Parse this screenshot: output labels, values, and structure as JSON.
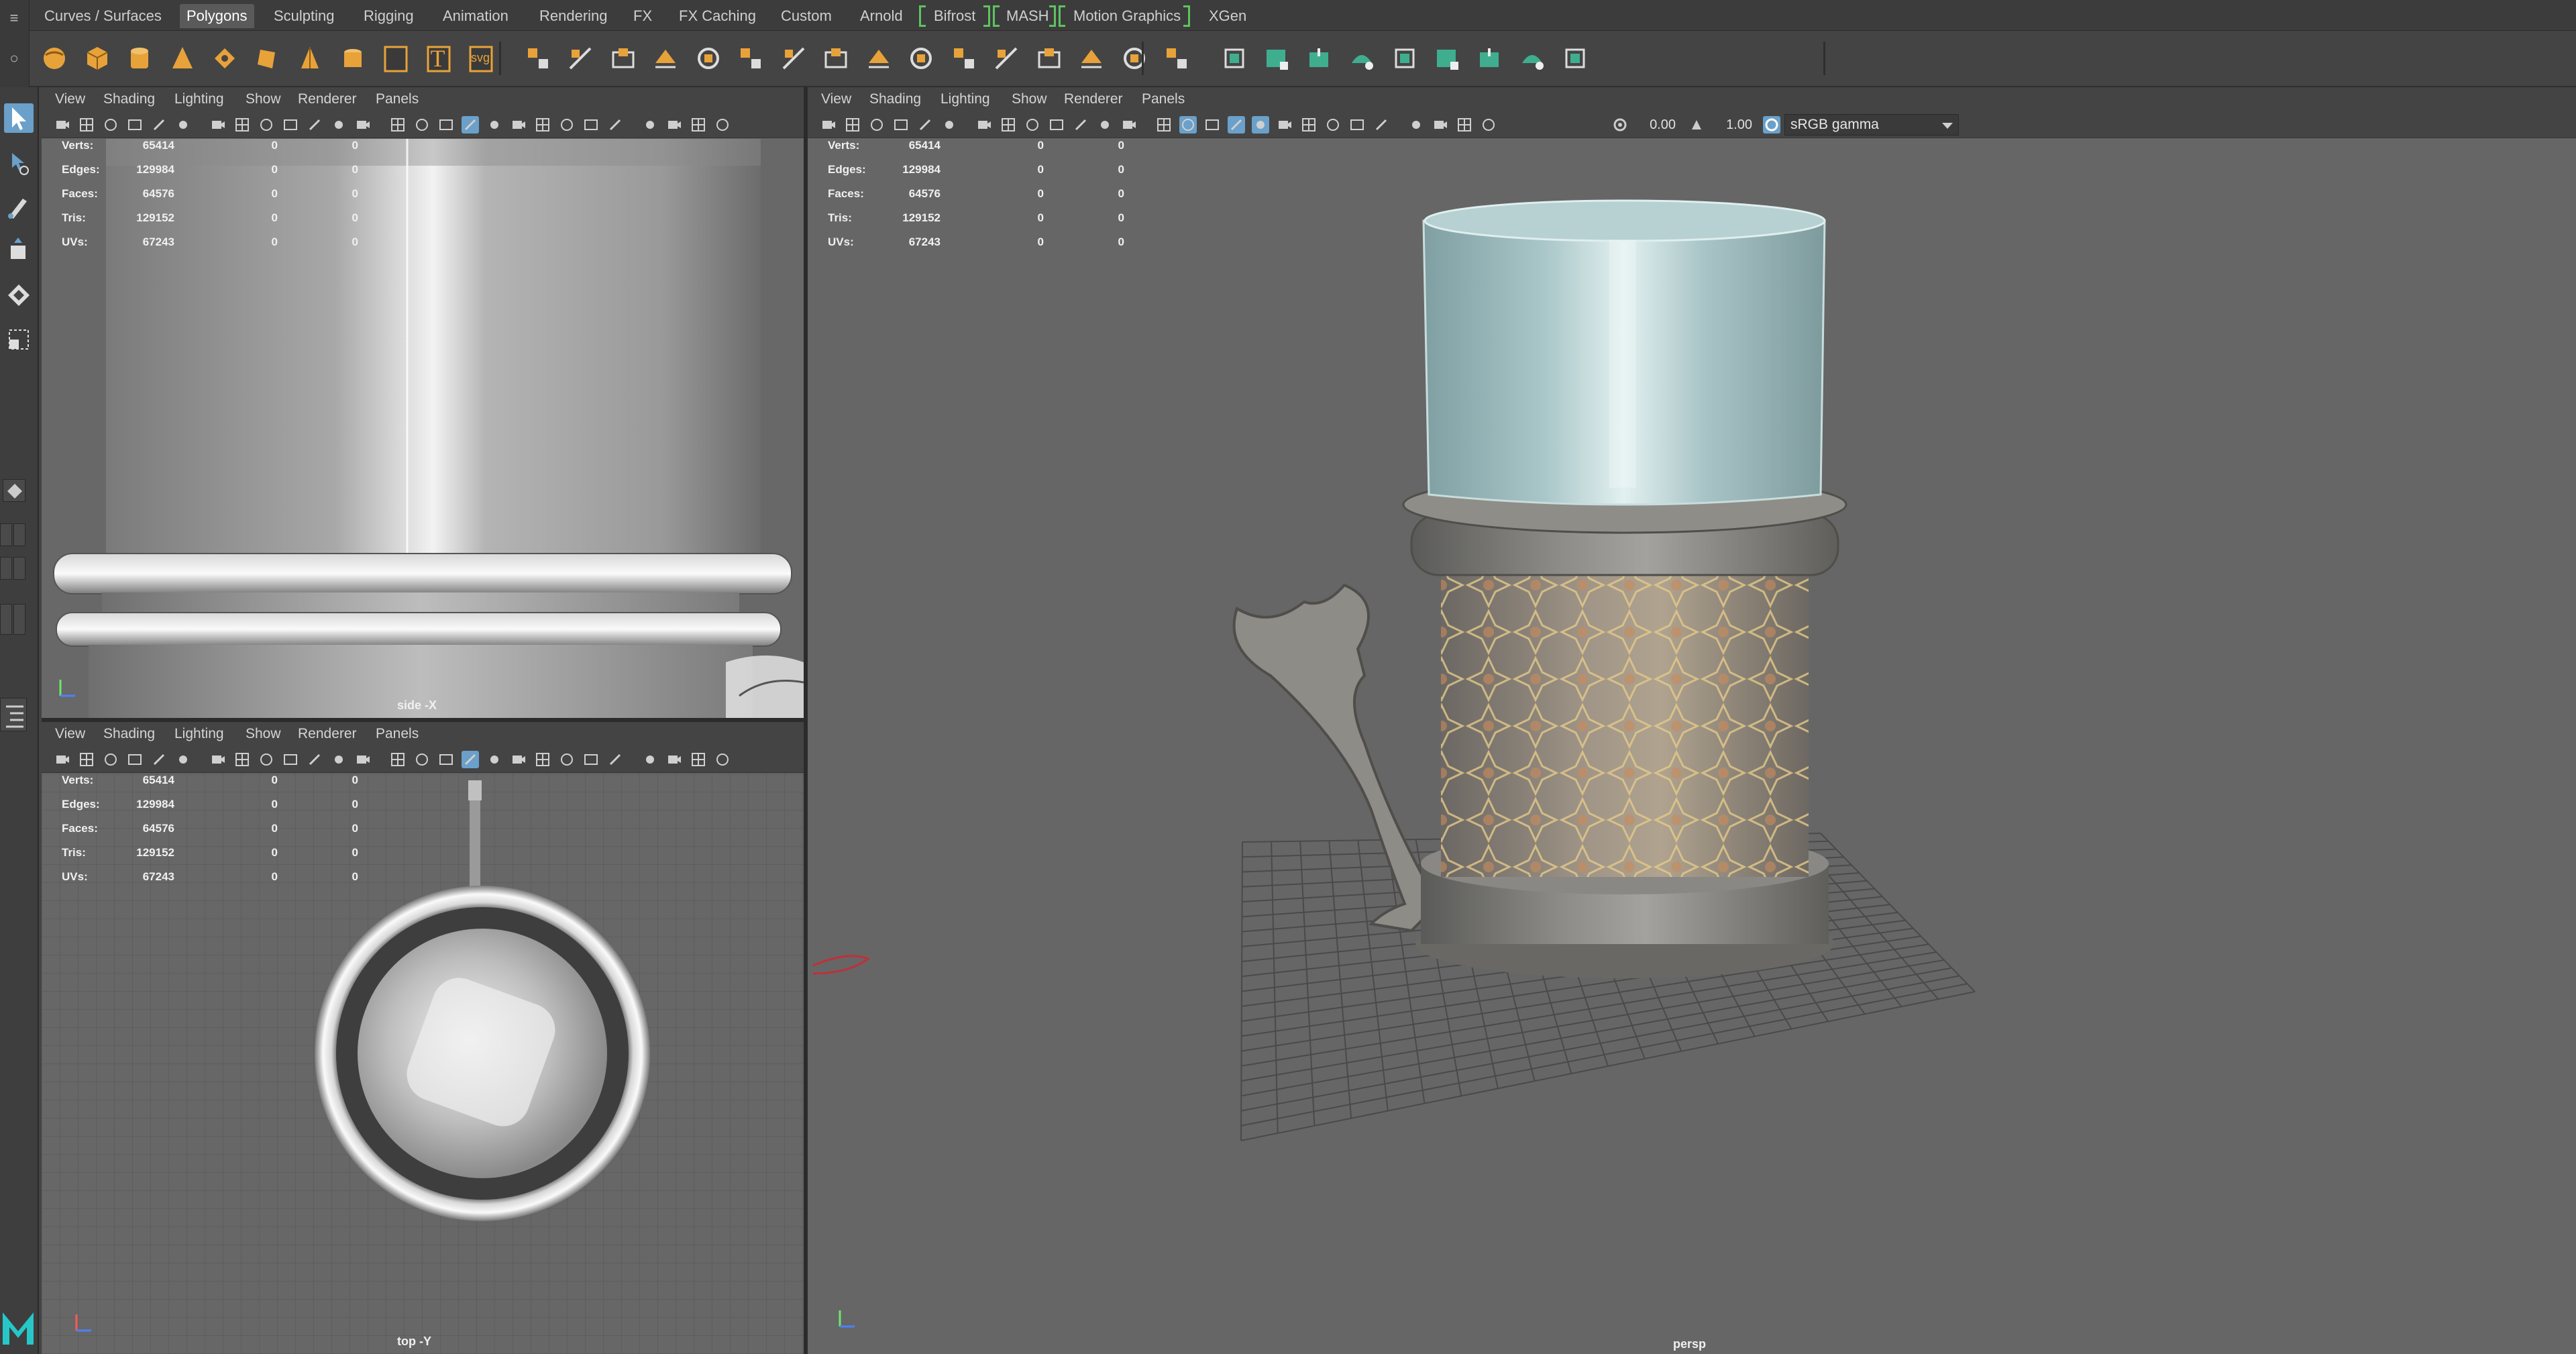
{
  "shelf": {
    "tabs": [
      "Curves / Surfaces",
      "Polygons",
      "Sculpting",
      "Rigging",
      "Animation",
      "Rendering",
      "FX",
      "FX Caching",
      "Custom",
      "Arnold",
      "Bifrost",
      "MASH",
      "Motion Graphics",
      "XGen"
    ],
    "active_tab": "Polygons",
    "icons": [
      "poly-sphere-icon",
      "poly-cube-icon",
      "poly-cylinder-icon",
      "poly-cone-icon",
      "poly-torus-icon",
      "poly-plane-icon",
      "poly-disc-icon",
      "poly-pyramid-icon",
      "poly-pipe-icon",
      "poly-text-icon",
      "svg-icon",
      "combine-icon",
      "separate-icon",
      "mirror-icon",
      "smooth-icon",
      "reduce-icon",
      "extract-icon",
      "bevel-icon",
      "bridge-icon",
      "extrude-icon",
      "multicut-icon",
      "target-weld-icon",
      "connect-icon",
      "append-icon",
      "fill-hole-icon",
      "merge-icon",
      "collapse-icon",
      "uv-editor-icon",
      "planar-uv-icon",
      "automatic-uv-icon",
      "cylindrical-uv-icon",
      "spherical-uv-icon",
      "cut-uv-icon",
      "sew-uv-icon",
      "unfold-uv-icon",
      "layout-uv-icon"
    ],
    "svg_label": "svg",
    "text_label": "T"
  },
  "panel_menu": [
    "View",
    "Shading",
    "Lighting",
    "Show",
    "Renderer",
    "Panels"
  ],
  "hud": {
    "labels": [
      "Verts:",
      "Edges:",
      "Faces:",
      "Tris:",
      "UVs:"
    ],
    "values": [
      [
        "65414",
        "0",
        "0"
      ],
      [
        "129984",
        "0",
        "0"
      ],
      [
        "64576",
        "0",
        "0"
      ],
      [
        "129152",
        "0",
        "0"
      ],
      [
        "67243",
        "0",
        "0"
      ]
    ]
  },
  "panels": {
    "side": {
      "camera": "side -X"
    },
    "top": {
      "camera": "top -Y"
    },
    "persp": {
      "camera": "persp",
      "exposure": "0.00",
      "gamma": "1.00",
      "color_space": "sRGB gamma"
    }
  },
  "colors": {
    "accent_blue": "#6aa0c9",
    "bracket_green": "#5fc25f",
    "shelf_orange": "#e8a23a",
    "viewport_bg": "#676767"
  }
}
